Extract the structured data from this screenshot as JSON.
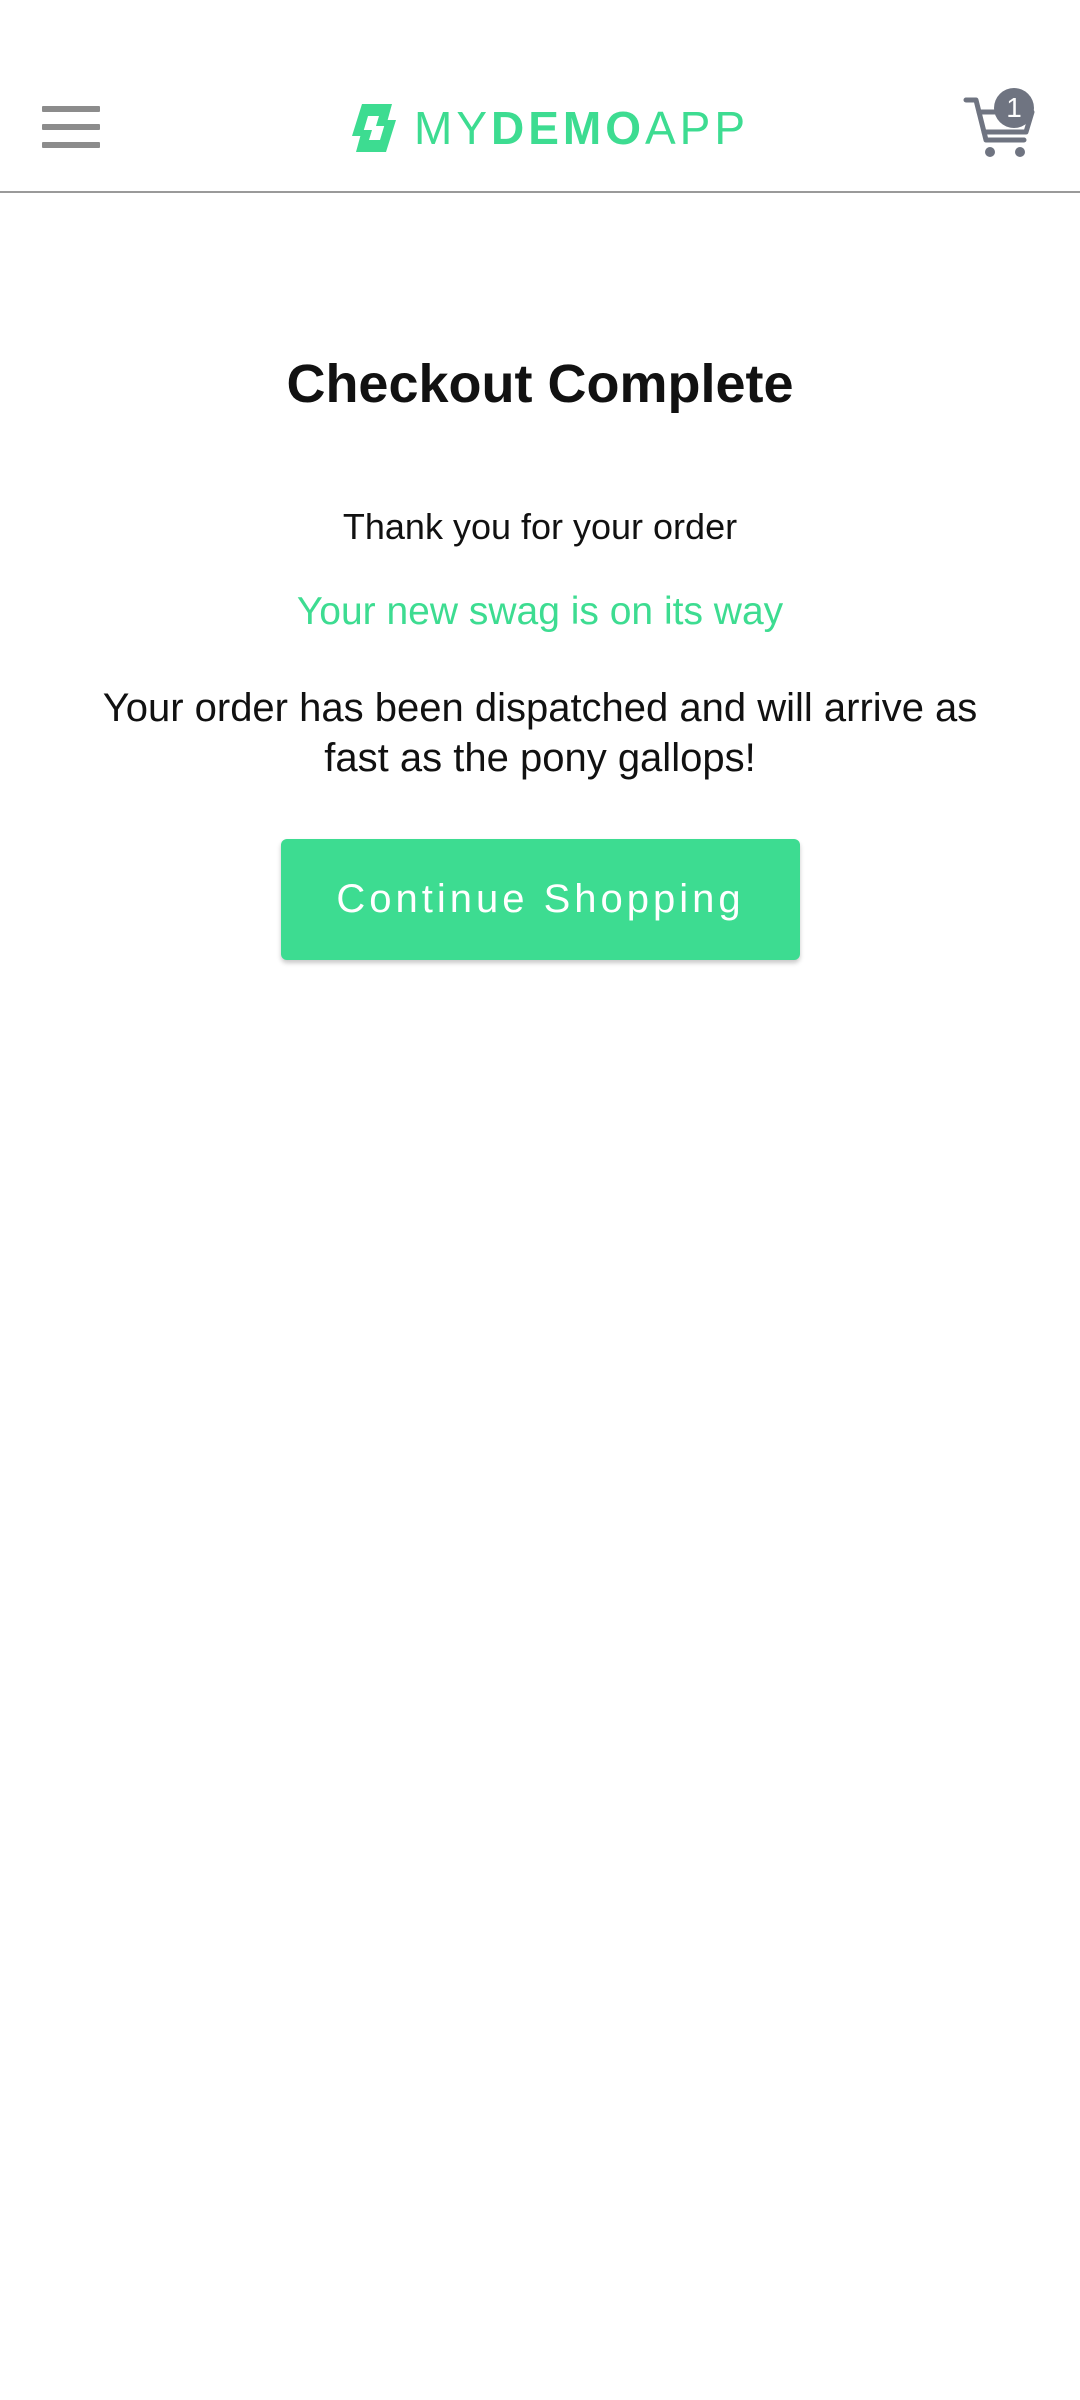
{
  "header": {
    "logo": {
      "part1": "MY",
      "part2": "DEMO",
      "part3": "APP"
    },
    "cart_count": "1"
  },
  "main": {
    "title": "Checkout Complete",
    "thank_you": "Thank you for your order",
    "swag_message": "Your new swag is on its way",
    "dispatch_message": "Your order has been dispatched and will arrive as fast as the pony gallops!",
    "continue_button_label": "Continue Shopping"
  },
  "colors": {
    "accent": "#3ddc91",
    "badge": "#6f7481",
    "menu_icon": "#8c8c8c"
  },
  "icons": {
    "menu": "hamburger-menu-icon",
    "logo": "lightning-bolt-logo-icon",
    "cart": "shopping-cart-icon"
  }
}
